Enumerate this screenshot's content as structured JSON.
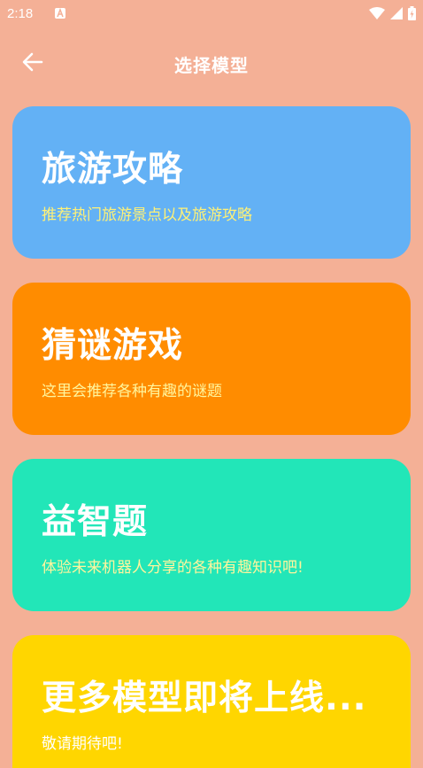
{
  "status_bar": {
    "time": "2:18"
  },
  "header": {
    "title": "选择模型"
  },
  "cards": [
    {
      "title": "旅游攻略",
      "desc": "推荐热门旅游景点以及旅游攻略",
      "bg": "#63B1F5",
      "desc_color": "#FFF176"
    },
    {
      "title": "猜谜游戏",
      "desc": "这里会推荐各种有趣的谜题",
      "bg": "#FF8C00",
      "desc_color": "#FFF59D"
    },
    {
      "title": "益智题",
      "desc": "体验未来机器人分享的各种有趣知识吧!",
      "bg": "#22E6B8",
      "desc_color": "#FFF59D"
    },
    {
      "title": "更多模型即将上线...",
      "desc": "敬请期待吧!",
      "bg": "#FFD600",
      "desc_color": "#FFFFFF"
    }
  ]
}
